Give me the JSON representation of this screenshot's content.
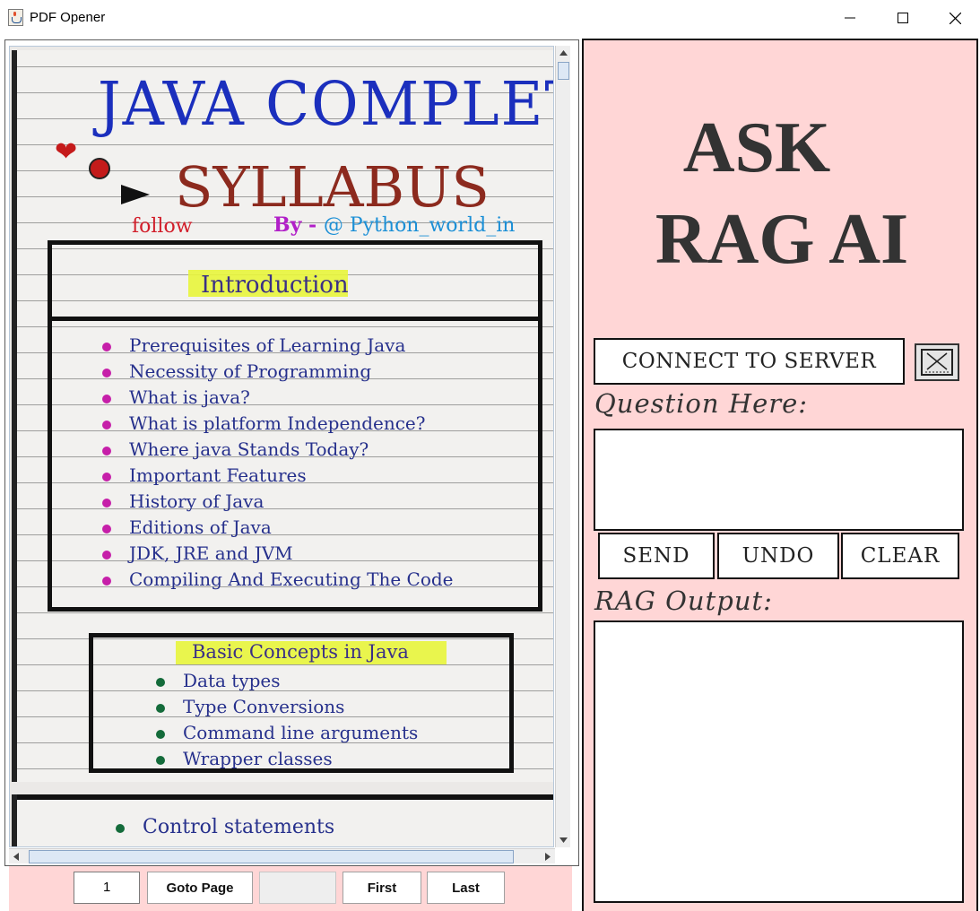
{
  "window": {
    "title": "PDF Opener",
    "icon": "java-cup-icon",
    "controls": [
      "minimize-icon",
      "maximize-icon",
      "close-icon"
    ]
  },
  "pdf_page": {
    "title_line1": "JAVA COMPLETE",
    "title_line2": "SYLLABUS",
    "follow": "follow",
    "by": "By - ",
    "handle": "@ Python_world_in",
    "intro_heading": "Introduction",
    "intro_items": [
      "Prerequisites of Learning Java",
      "Necessity of Programming",
      "What is java?",
      "What is platform Independence?",
      "Where java Stands Today?",
      "Important Features",
      "History of Java",
      "Editions of Java",
      "JDK, JRE and JVM",
      "Compiling And Executing The Code"
    ],
    "basic_heading": "Basic Concepts in Java",
    "basic_items": [
      "Data types",
      "Type Conversions",
      "Command line arguments",
      "Wrapper classes"
    ],
    "next_item": "Control statements"
  },
  "navigation": {
    "page_value": "1",
    "goto_label": "Goto Page",
    "first_label": "First",
    "last_label": "Last"
  },
  "rag": {
    "title_line1": "ASK",
    "title_line2": "RAG AI",
    "connect_label": "CONNECT TO SERVER",
    "question_label": "Question Here:",
    "send_label": "SEND",
    "undo_label": "UNDO",
    "clear_label": "CLEAR",
    "output_label": "RAG Output:",
    "question_value": "",
    "output_value": ""
  },
  "colors": {
    "panel_bg": "#ffd6d6",
    "title_text": "#333333",
    "ink_blue": "#1b2fbd",
    "ink_red": "#8c2a1e"
  }
}
